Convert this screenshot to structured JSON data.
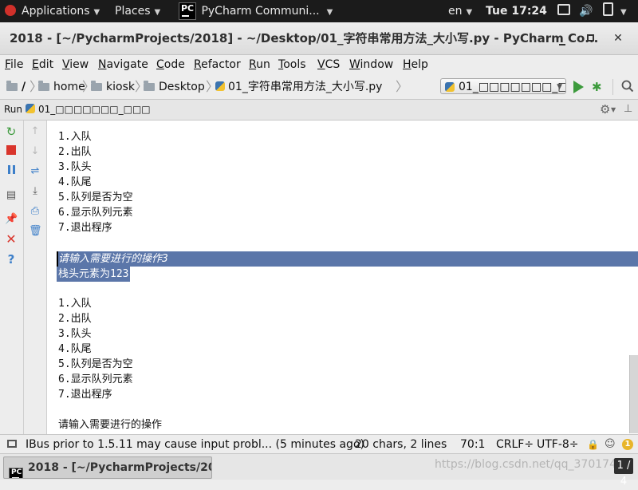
{
  "topbar": {
    "applications": "Applications",
    "places": "Places",
    "app_name": "PyCharm Communi...",
    "pc_logo_text": "PC",
    "lang": "en",
    "clock": "Tue 17:24"
  },
  "window": {
    "title": "2018 - [~/PycharmProjects/2018] - ~/Desktop/01_字符串常用方法_大小写.py - PyCharm Co..."
  },
  "menu": {
    "items": [
      "File",
      "Edit",
      "View",
      "Navigate",
      "Code",
      "Refactor",
      "Run",
      "Tools",
      "VCS",
      "Window",
      "Help"
    ]
  },
  "nav": {
    "crumbs": [
      "/",
      "home",
      "kiosk",
      "Desktop",
      "01_字符串常用方法_大小写.py"
    ],
    "run_config": "01_□□□□□□□_□□□"
  },
  "run_panel": {
    "label": "Run",
    "tab": "01_□□□□□□□_□□□"
  },
  "console": {
    "lines": [
      "1.入队",
      "2.出队",
      "3.队头",
      "4.队尾",
      "5.队列是否为空",
      "6.显示队列元素",
      "7.退出程序",
      "",
      "请输入需要进行的操作3",
      "栈头元素为123",
      "",
      "1.入队",
      "2.出队",
      "3.队头",
      "4.队尾",
      "5.队列是否为空",
      "6.显示队列元素",
      "7.退出程序",
      "",
      "请输入需要进行的操作"
    ],
    "selected_line_full": 8,
    "selected_line_partial": 9
  },
  "status": {
    "message": "IBus prior to 1.5.11 may cause input probl... (5 minutes ago)",
    "selection": "20 chars, 2 lines",
    "position": "70:1",
    "line_sep": "CRLF÷",
    "encoding": "UTF-8÷",
    "notif_count": "1"
  },
  "taskbar": {
    "item": "2018 - [~/PycharmProjects/201...",
    "watermark": "https://blog.csdn.net/qq_37017483",
    "workspace": "1 / 4"
  },
  "colors": {
    "selection": "#5b76a9",
    "run_green": "#3c9a3c",
    "stop_red": "#d9352c",
    "pause_blue": "#3d7fc9"
  }
}
